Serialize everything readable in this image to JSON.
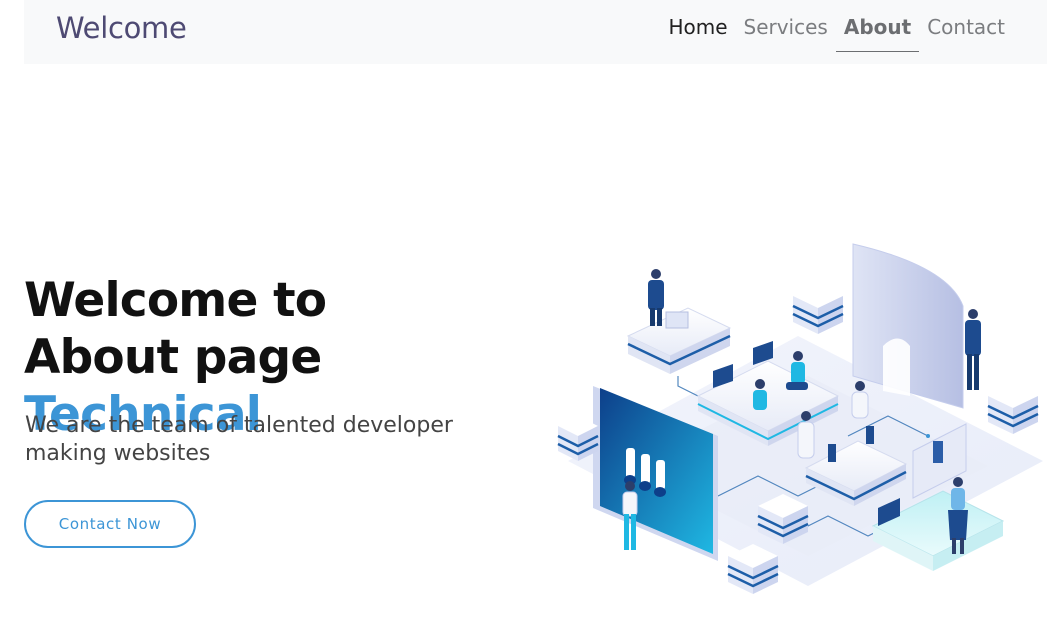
{
  "navbar": {
    "brand": "Welcome",
    "links": [
      {
        "label": "Home"
      },
      {
        "label": "Services"
      },
      {
        "label": "About"
      },
      {
        "label": "Contact"
      }
    ]
  },
  "hero": {
    "title_prefix": "Welcome to About page ",
    "title_accent": "Technical",
    "subtitle": "We are the team of talented developer making websites",
    "cta_label": "Contact Now"
  },
  "colors": {
    "accent": "#3c95d6",
    "nav_background": "#f8f9fa",
    "brand": "#4e4a73"
  },
  "illustration": {
    "icon": "isometric-tech-team-illustration"
  }
}
